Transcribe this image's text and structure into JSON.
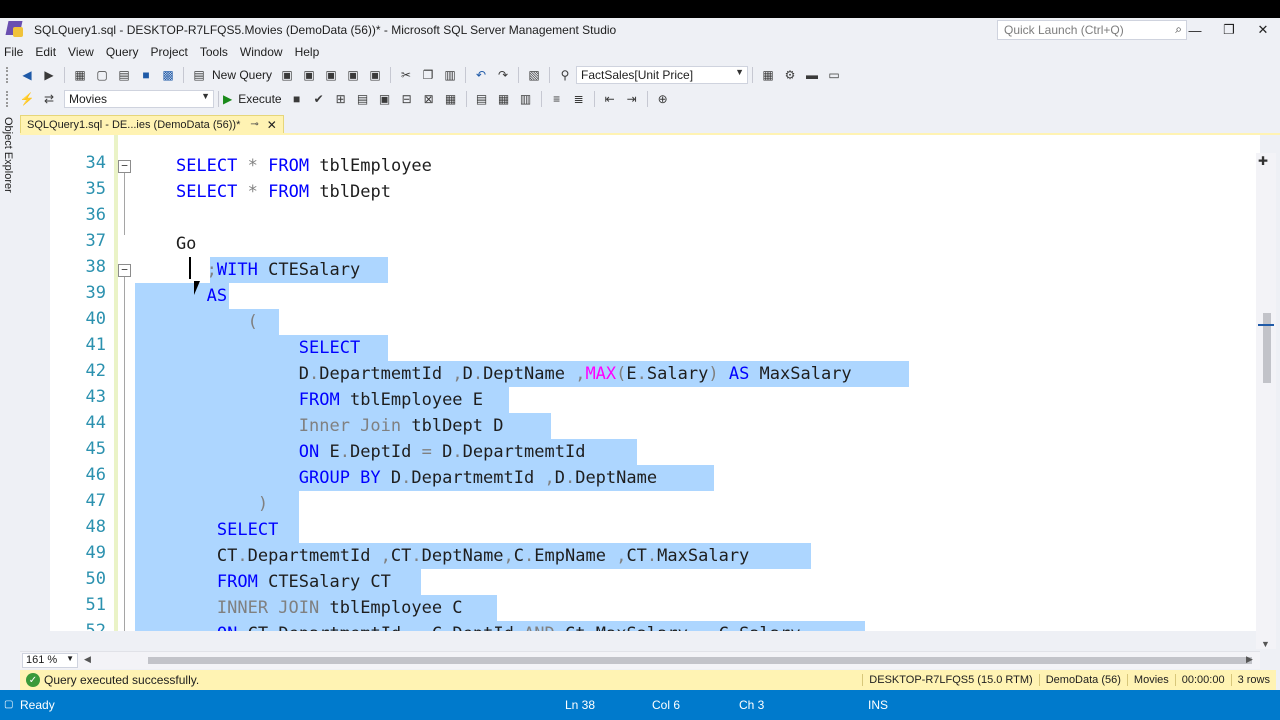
{
  "window": {
    "title": "SQLQuery1.sql - DESKTOP-R7LFQS5.Movies (DemoData (56))* - Microsoft SQL Server Management Studio",
    "quick_launch_placeholder": "Quick Launch (Ctrl+Q)"
  },
  "menu": [
    "File",
    "Edit",
    "View",
    "Query",
    "Project",
    "Tools",
    "Window",
    "Help"
  ],
  "toolbar": {
    "new_query": "New Query",
    "measure": "FactSales[Unit Price]",
    "database": "Movies",
    "execute": "Execute"
  },
  "sidebar": {
    "object_explorer": "Object Explorer"
  },
  "tab": {
    "label": "SQLQuery1.sql - DE...ies (DemoData (56))*",
    "pin": "⊸",
    "close": "✕"
  },
  "editor": {
    "line_numbers": [
      "34",
      "35",
      "36",
      "37",
      "38",
      "39",
      "40",
      "41",
      "42",
      "43",
      "44",
      "45",
      "46",
      "47",
      "48",
      "49",
      "50",
      "51",
      "52"
    ]
  },
  "zoom": "161 %",
  "query_status": {
    "message": "Query executed successfully.",
    "server": "DESKTOP-R7LFQS5 (15.0 RTM)",
    "login": "DemoData (56)",
    "database": "Movies",
    "elapsed": "00:00:00",
    "rows": "3 rows"
  },
  "status_bar": {
    "state": "Ready",
    "line": "Ln 38",
    "col": "Col 6",
    "ch": "Ch 3",
    "mode": "INS"
  },
  "colors": {
    "accent": "#007acc",
    "tab_bg": "#fff3b3",
    "selection": "#add6ff",
    "keyword": "#0000ff",
    "function": "#ff00ff",
    "gray": "#808080",
    "line_number": "#2b91af"
  }
}
